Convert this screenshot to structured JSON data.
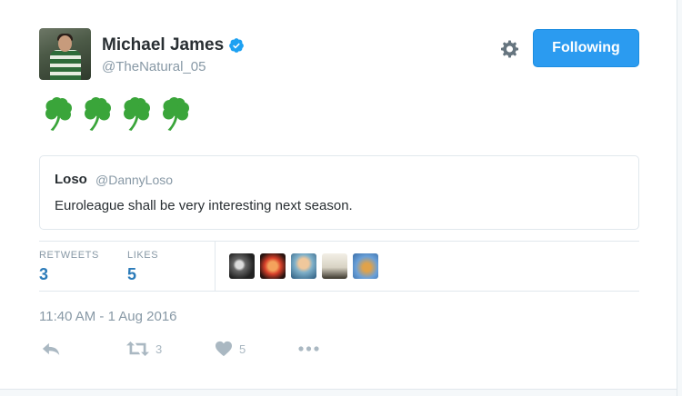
{
  "tweet": {
    "author_name": "Michael James",
    "author_handle": "@TheNatural_05",
    "follow_label": "Following",
    "body_emoji": [
      "shamrock",
      "shamrock",
      "shamrock",
      "shamrock"
    ],
    "quoted": {
      "name": "Loso",
      "handle": "@DannyLoso",
      "text": "Euroleague shall be very interesting next season."
    },
    "stats": {
      "retweets_label": "RETWEETS",
      "retweets": "3",
      "likes_label": "LIKES",
      "likes": "5"
    },
    "timestamp": "11:40 AM - 1 Aug 2016",
    "actions": {
      "retweet_count": "3",
      "like_count": "5"
    }
  },
  "colors": {
    "accent": "#2b9bf0",
    "link": "#2b7bb9",
    "muted": "#8899a6",
    "shamrock": "#3aa53a"
  },
  "icons": [
    "verified-badge-icon",
    "gear-icon",
    "shamrock-icon",
    "reply-icon",
    "retweet-icon",
    "heart-icon",
    "more-icon"
  ]
}
